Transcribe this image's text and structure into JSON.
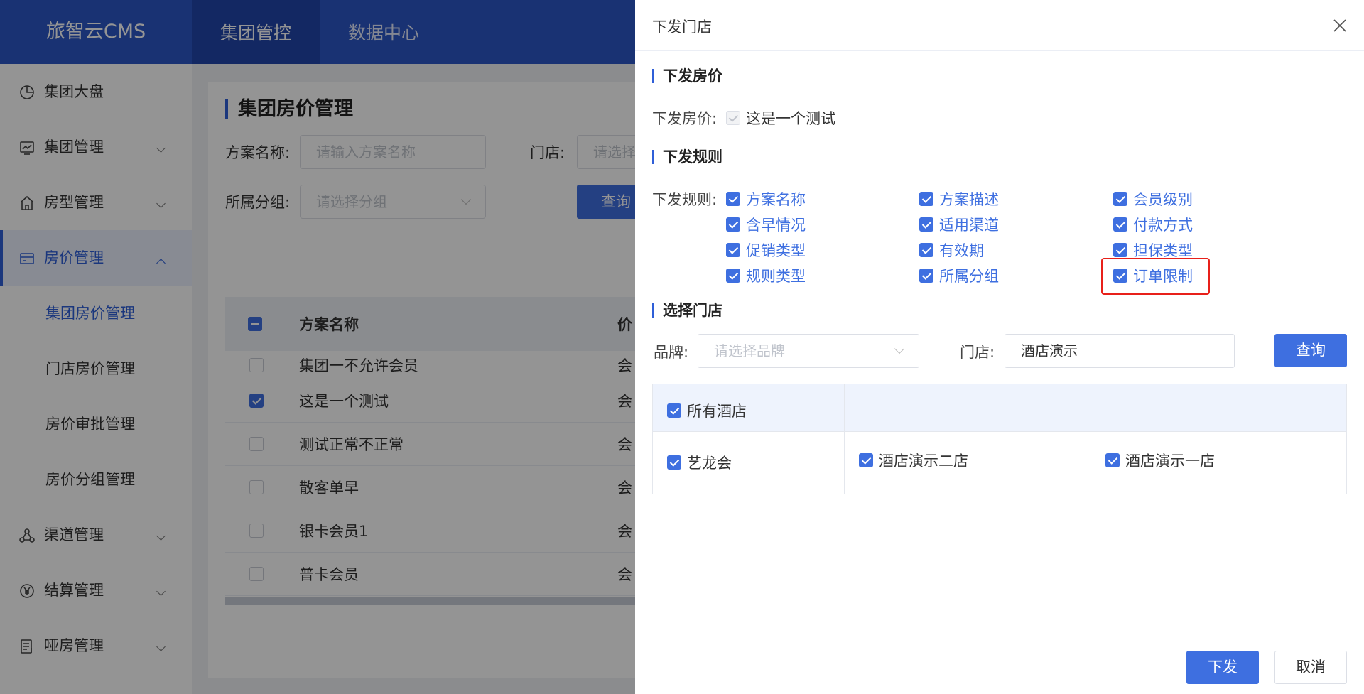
{
  "app": {
    "logo": "旅智云CMS"
  },
  "top_nav": [
    {
      "label": "集团管控",
      "active": true
    },
    {
      "label": "数据中心",
      "active": false
    }
  ],
  "sidebar": {
    "items": [
      {
        "label": "集团大盘",
        "icon": "dashboard-icon"
      },
      {
        "label": "集团管理",
        "icon": "monitor-chart-icon"
      },
      {
        "label": "房型管理",
        "icon": "home-icon"
      },
      {
        "label": "房价管理",
        "icon": "card-icon"
      },
      {
        "label": "渠道管理",
        "icon": "channel-icon"
      },
      {
        "label": "结算管理",
        "icon": "yen-icon"
      },
      {
        "label": "哑房管理",
        "icon": "document-icon"
      }
    ],
    "sub_items": [
      {
        "label": "集团房价管理",
        "active": true
      },
      {
        "label": "门店房价管理",
        "active": false
      },
      {
        "label": "房价审批管理",
        "active": false
      },
      {
        "label": "房价分组管理",
        "active": false
      }
    ]
  },
  "main": {
    "title": "集团房价管理",
    "filters": {
      "scheme_label": "方案名称:",
      "scheme_placeholder": "请输入方案名称",
      "store_label": "门店:",
      "store_placeholder": "请选择",
      "group_label": "所属分组:",
      "group_placeholder": "请选择分组",
      "query_button": "查询"
    },
    "table": {
      "columns": [
        "方案名称",
        "价"
      ],
      "rows": [
        {
          "name": "集团一不允许会员",
          "col2": "会",
          "checked": false
        },
        {
          "name": "这是一个测试",
          "col2": "会",
          "checked": true
        },
        {
          "name": "测试正常不正常",
          "col2": "会",
          "checked": false
        },
        {
          "name": "散客单早",
          "col2": "会",
          "checked": false
        },
        {
          "name": "银卡会员1",
          "col2": "会",
          "checked": false
        },
        {
          "name": "普卡会员",
          "col2": "会",
          "checked": false
        }
      ]
    }
  },
  "drawer": {
    "title": "下发门店",
    "section_price": "下发房价",
    "price_label": "下发房价:",
    "price_value": "这是一个测试",
    "section_rules": "下发规则",
    "rules_label": "下发规则:",
    "rules": [
      [
        "方案名称",
        "方案描述",
        "会员级别"
      ],
      [
        "含早情况",
        "适用渠道",
        "付款方式"
      ],
      [
        "促销类型",
        "有效期",
        "担保类型"
      ],
      [
        "规则类型",
        "所属分组",
        "订单限制"
      ]
    ],
    "section_store": "选择门店",
    "brand_label": "品牌:",
    "brand_placeholder": "请选择品牌",
    "store_label": "门店:",
    "store_value": "酒店演示",
    "query_button": "查询",
    "all_hotels": "所有酒店",
    "brand_row": {
      "brand": "艺龙会",
      "hotels": [
        "酒店演示二店",
        "酒店演示一店"
      ]
    },
    "confirm_button": "下发",
    "cancel_button": "取消"
  },
  "colors": {
    "primary": "#3e6fe0",
    "header": "#2b56c6",
    "highlight": "#e8201a"
  }
}
